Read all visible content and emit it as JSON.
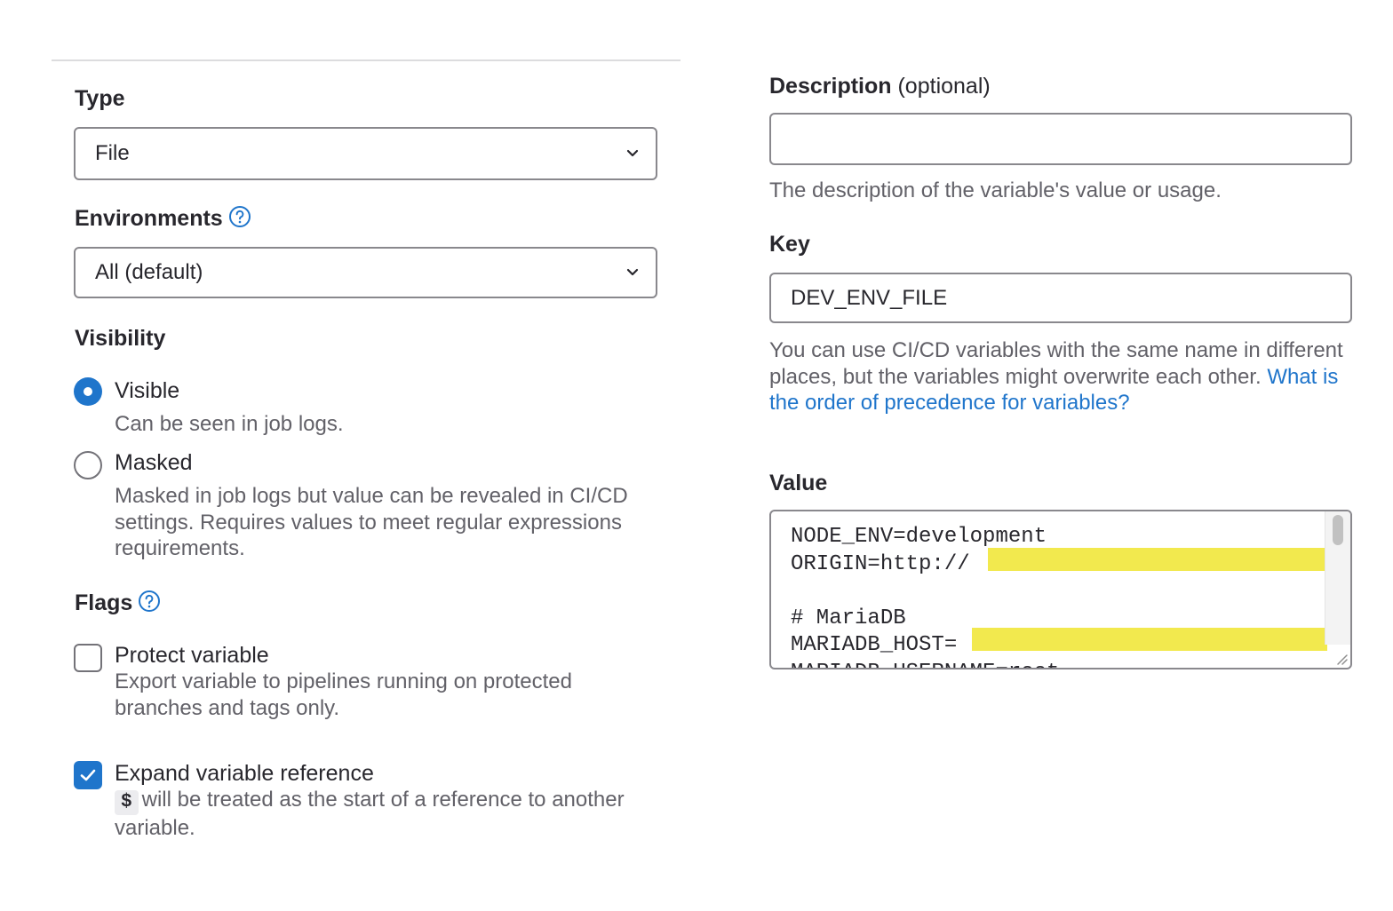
{
  "type": {
    "label": "Type",
    "value": "File"
  },
  "environments": {
    "label": "Environments",
    "value": "All (default)"
  },
  "visibility": {
    "label": "Visibility",
    "options": [
      {
        "label": "Visible",
        "help": "Can be seen in job logs.",
        "selected": true
      },
      {
        "label": "Masked",
        "help": "Masked in job logs but value can be revealed in CI/CD settings. Requires values to meet regular expressions requirements.",
        "selected": false
      }
    ]
  },
  "flags": {
    "label": "Flags",
    "protect": {
      "label": "Protect variable",
      "help": "Export variable to pipelines running on protected branches and tags only.",
      "checked": false
    },
    "expand": {
      "label": "Expand variable reference",
      "code": "$",
      "help": "will be treated as the start of a reference to another variable.",
      "checked": true
    }
  },
  "description": {
    "label": "Description",
    "optional": "(optional)",
    "value": "",
    "help": "The description of the variable's value or usage."
  },
  "key": {
    "label": "Key",
    "value": "DEV_ENV_FILE",
    "help": "You can use CI/CD variables with the same name in different places, but the variables might overwrite each other.",
    "link": "What is the order of precedence for variables?"
  },
  "value": {
    "label": "Value",
    "content": "NODE_ENV=development\nORIGIN=http://\n\n# MariaDB\nMARIADB_HOST=\nMARIADB_USERNAME=root"
  },
  "colors": {
    "accent": "#1f75cb",
    "redaction": "#f2e94e"
  },
  "icons": {
    "help": "question-circle-icon",
    "select": "chevron-down-icon",
    "check": "check-icon"
  }
}
